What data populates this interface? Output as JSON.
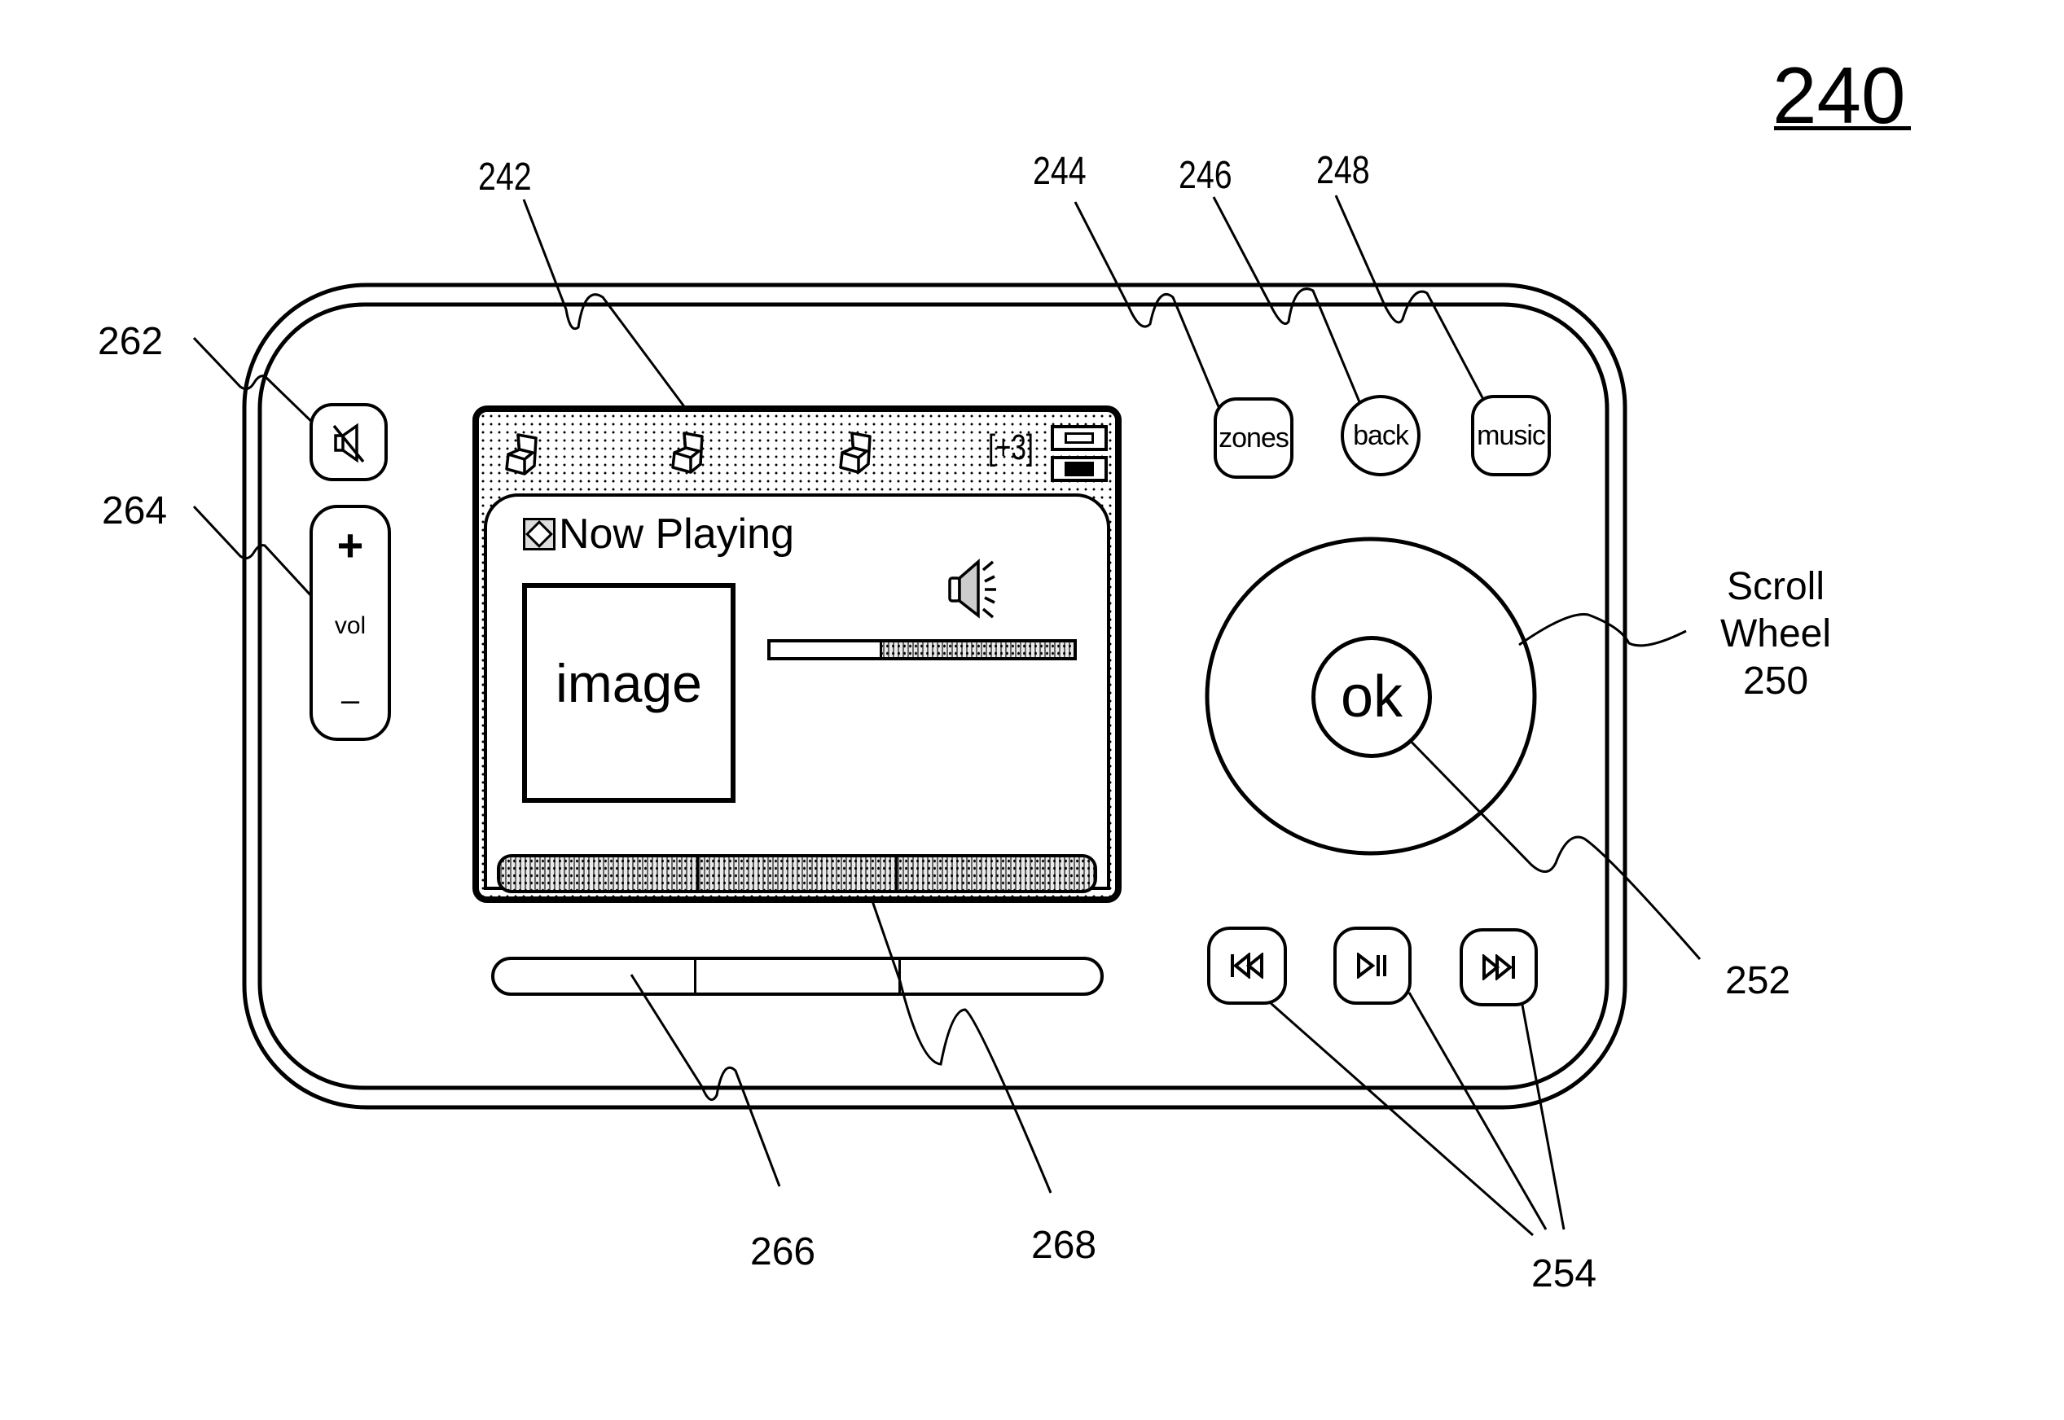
{
  "figure": {
    "number": "240"
  },
  "reference_labels": {
    "display": "242",
    "zones": "244",
    "back": "246",
    "music": "248",
    "ok": "252",
    "transport": "254",
    "mute": "262",
    "volume": "264",
    "hard_softkeys": "266",
    "screen_softkeys": "268"
  },
  "scroll_wheel_label": {
    "line1": "Scroll",
    "line2": "Wheel",
    "line3": "250"
  },
  "buttons": {
    "zones": "zones",
    "back": "back",
    "music": "music",
    "ok": "ok",
    "volume_up": "+",
    "volume_label": "vol",
    "volume_down": "–"
  },
  "transport_icons": {
    "previous": "previous-track-icon",
    "play_pause": "play-pause-icon",
    "next": "next-track-icon"
  },
  "screen": {
    "status_bar": {
      "zones": [
        "zone-player-icon",
        "zone-player-icon",
        "zone-player-icon"
      ],
      "additional_zones": "[+3]"
    },
    "title": "Now Playing",
    "album_art_placeholder": "image",
    "progress": 0.36,
    "softkeys": [
      "",
      "",
      ""
    ]
  }
}
